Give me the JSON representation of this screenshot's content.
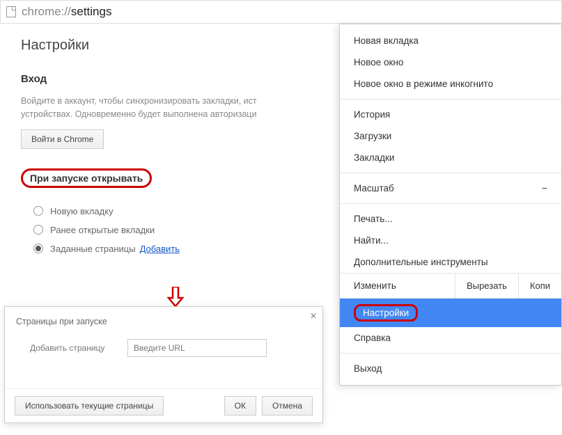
{
  "url": {
    "scheme": "chrome://",
    "path": "settings"
  },
  "page": {
    "title": "Настройки",
    "login": {
      "heading": "Вход",
      "body_line1": "Войдите в аккаунт, чтобы синхронизировать закладки, ист",
      "body_line2": "устройствах. Одновременно будет выполнена авторизаци",
      "button": "Войти в Chrome"
    },
    "startup": {
      "heading": "При запуске открывать",
      "opts": [
        "Новую вкладку",
        "Ранее открытые вкладки",
        "Заданные страницы"
      ],
      "add_link": "Добавить"
    }
  },
  "dialog": {
    "title": "Страницы при запуске",
    "field_label": "Добавить страницу",
    "placeholder": "Введите URL",
    "use_current": "Использовать текущие страницы",
    "ok": "ОК",
    "cancel": "Отмена"
  },
  "menu": {
    "new_tab": "Новая вкладка",
    "new_window": "Новое окно",
    "incognito": "Новое окно в режиме инкогнито",
    "history": "История",
    "downloads": "Загрузки",
    "bookmarks": "Закладки",
    "zoom": "Масштаб",
    "print": "Печать...",
    "find": "Найти...",
    "tools": "Дополнительные инструменты",
    "edit_label": "Изменить",
    "cut": "Вырезать",
    "copy": "Копи",
    "settings": "Настройки",
    "help": "Справка",
    "exit": "Выход"
  }
}
